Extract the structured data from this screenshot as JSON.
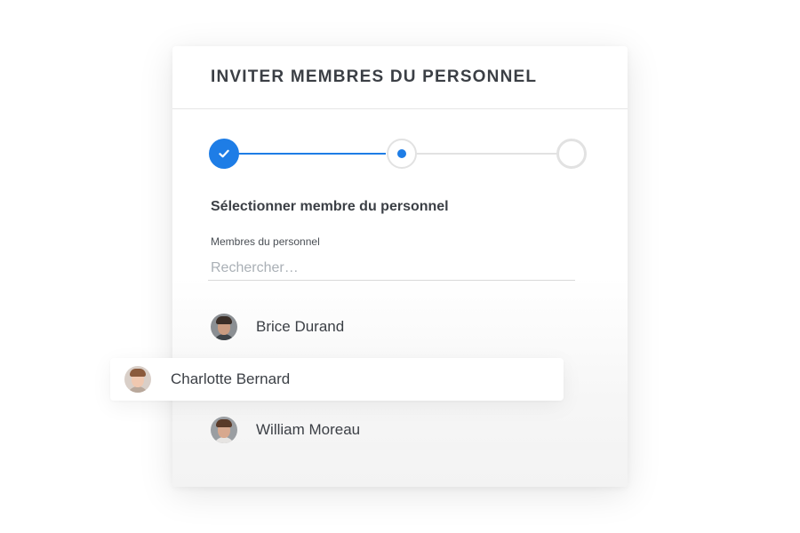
{
  "dialog": {
    "title": "INVITER MEMBRES DU PERSONNEL"
  },
  "stepper": {
    "current_step": 2,
    "total_steps": 3,
    "steps": [
      {
        "state": "completed",
        "icon": "check-icon"
      },
      {
        "state": "active"
      },
      {
        "state": "pending"
      }
    ],
    "accent_color": "#1e7de6",
    "inactive_color": "#e2e2e2"
  },
  "selection": {
    "heading": "Sélectionner membre du personnel",
    "field_label": "Membres du personnel",
    "search_placeholder": "Rechercher…",
    "search_value": ""
  },
  "staff": [
    {
      "name": "Brice Durand",
      "avatar": "avatar-photo"
    },
    {
      "name": "Charlotte Bernard",
      "avatar": "avatar-photo",
      "highlighted": true
    },
    {
      "name": "William Moreau",
      "avatar": "avatar-photo"
    }
  ]
}
